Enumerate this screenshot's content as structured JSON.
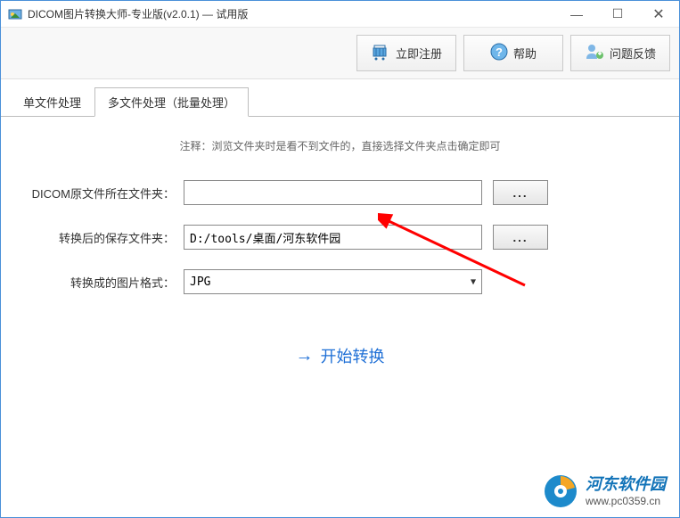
{
  "window": {
    "title": "DICOM图片转换大师-专业版(v2.0.1) — 试用版"
  },
  "toolbar": {
    "register": "立即注册",
    "help": "帮助",
    "feedback": "问题反馈"
  },
  "tabs": {
    "single": "单文件处理",
    "multi": "多文件处理（批量处理）"
  },
  "hint": "注释：浏览文件夹时是看不到文件的，直接选择文件夹点击确定即可",
  "labels": {
    "src": "DICOM原文件所在文件夹：",
    "dst": "转换后的保存文件夹：",
    "fmt": "转换成的图片格式："
  },
  "fields": {
    "src": "",
    "dst": "D:/tools/桌面/河东软件园",
    "fmt": "JPG",
    "browse": "..."
  },
  "start": "开始转换",
  "brand": {
    "name": "河东软件园",
    "url": "www.pc0359.cn"
  }
}
